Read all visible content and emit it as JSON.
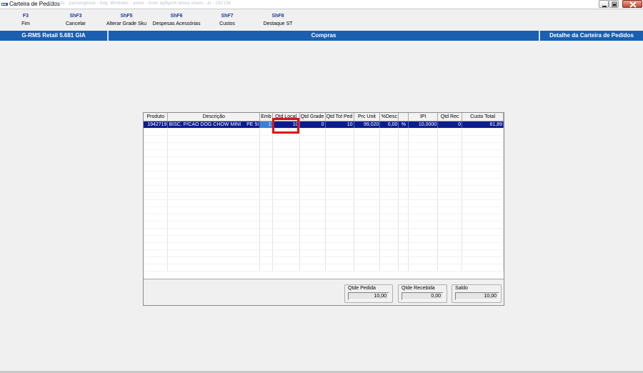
{
  "window": {
    "title": "Carteira de Pedidos",
    "blurred_text": "cgtessiis . pascengesse - hdg. Windows - asteo - hiser ag9gesh wisus shaes...ar - 252136"
  },
  "toolbar": [
    {
      "key": "F3",
      "label": "Fim"
    },
    {
      "key": "ShF3",
      "label": "Cancelar"
    },
    {
      "key": "ShF5",
      "label": "Alterar Grade Sku"
    },
    {
      "key": "ShF6",
      "label": "Despesas Acessórias"
    },
    {
      "key": "ShF7",
      "label": "Custos"
    },
    {
      "key": "ShF8",
      "label": "Destaque ST"
    }
  ],
  "statusbar": {
    "left": "G-RMS Retail 5.681 GIA",
    "middle": "Compras",
    "right": "Detalhe da Carteira de Pedidos"
  },
  "grid": {
    "columns": [
      "Produto",
      "Descrição",
      "Emb",
      "Qtd Local",
      "Qtd Grade",
      "Qtd Tot Ped",
      "Prc Unit",
      "%Desc",
      "",
      "IPI",
      "Qtd Rec",
      "Custo Total"
    ],
    "rows": [
      [
        "1942719",
        "BISC. P/CAO DOG CHOW MINI",
        "PE 5I",
        "1",
        "10",
        "0",
        "10",
        "99,020",
        "0,00",
        "%",
        "10,0000",
        "0",
        "61,89"
      ]
    ]
  },
  "totals": {
    "pedida": {
      "label": "Qtde Pedida",
      "value": "10,00"
    },
    "recebida": {
      "label": "Qtde Recebida",
      "value": "0,00"
    },
    "saldo": {
      "label": "Saldo",
      "value": "10,00"
    }
  },
  "colors": {
    "statusbar": "#1a5fb0",
    "selected_row": "#0b1c8f",
    "highlight": "#e01010"
  }
}
